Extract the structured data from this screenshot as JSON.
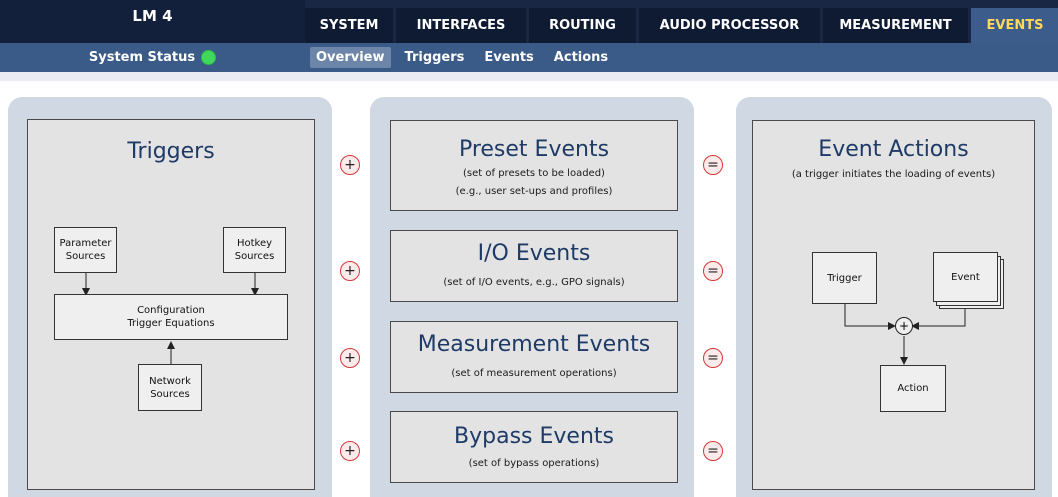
{
  "app": {
    "title": "LM 4"
  },
  "tabs": [
    {
      "label": "SYSTEM",
      "active": false
    },
    {
      "label": "INTERFACES",
      "active": false
    },
    {
      "label": "ROUTING",
      "active": false
    },
    {
      "label": "AUDIO PROCESSOR",
      "active": false
    },
    {
      "label": "MEASUREMENT",
      "active": false
    },
    {
      "label": "EVENTS",
      "active": true
    }
  ],
  "status": {
    "label": "System Status",
    "color": "#3fd85a"
  },
  "subnav": [
    {
      "label": "Overview",
      "active": true
    },
    {
      "label": "Triggers",
      "active": false
    },
    {
      "label": "Events",
      "active": false
    },
    {
      "label": "Actions",
      "active": false
    }
  ],
  "triggers": {
    "title": "Triggers",
    "parameter_sources": "Parameter\nSources",
    "hotkey_sources": "Hotkey\nSources",
    "configuration": "Configuration\nTrigger Equations",
    "network_sources": "Network\nSources"
  },
  "events": [
    {
      "title": "Preset Events",
      "notes": [
        "(set of presets to be loaded)",
        "(e.g., user set-ups and profiles)"
      ]
    },
    {
      "title": "I/O Events",
      "notes": [
        "(set of I/O events, e.g., GPO signals)"
      ]
    },
    {
      "title": "Measurement Events",
      "notes": [
        "(set of measurement operations)"
      ]
    },
    {
      "title": "Bypass Events",
      "notes": [
        "(set of bypass operations)"
      ]
    }
  ],
  "operators": {
    "plus": "+",
    "equals": "="
  },
  "actions": {
    "title": "Event Actions",
    "note": "(a trigger initiates the loading of events)",
    "trigger": "Trigger",
    "event": "Event",
    "plus": "+",
    "action": "Action"
  },
  "colors": {
    "accent": "#ffd85a",
    "nav_dark": "#1a2744",
    "subbar": "#3a5a87",
    "operator_ring": "#d43a3a",
    "title_blue": "#1e3a66"
  }
}
